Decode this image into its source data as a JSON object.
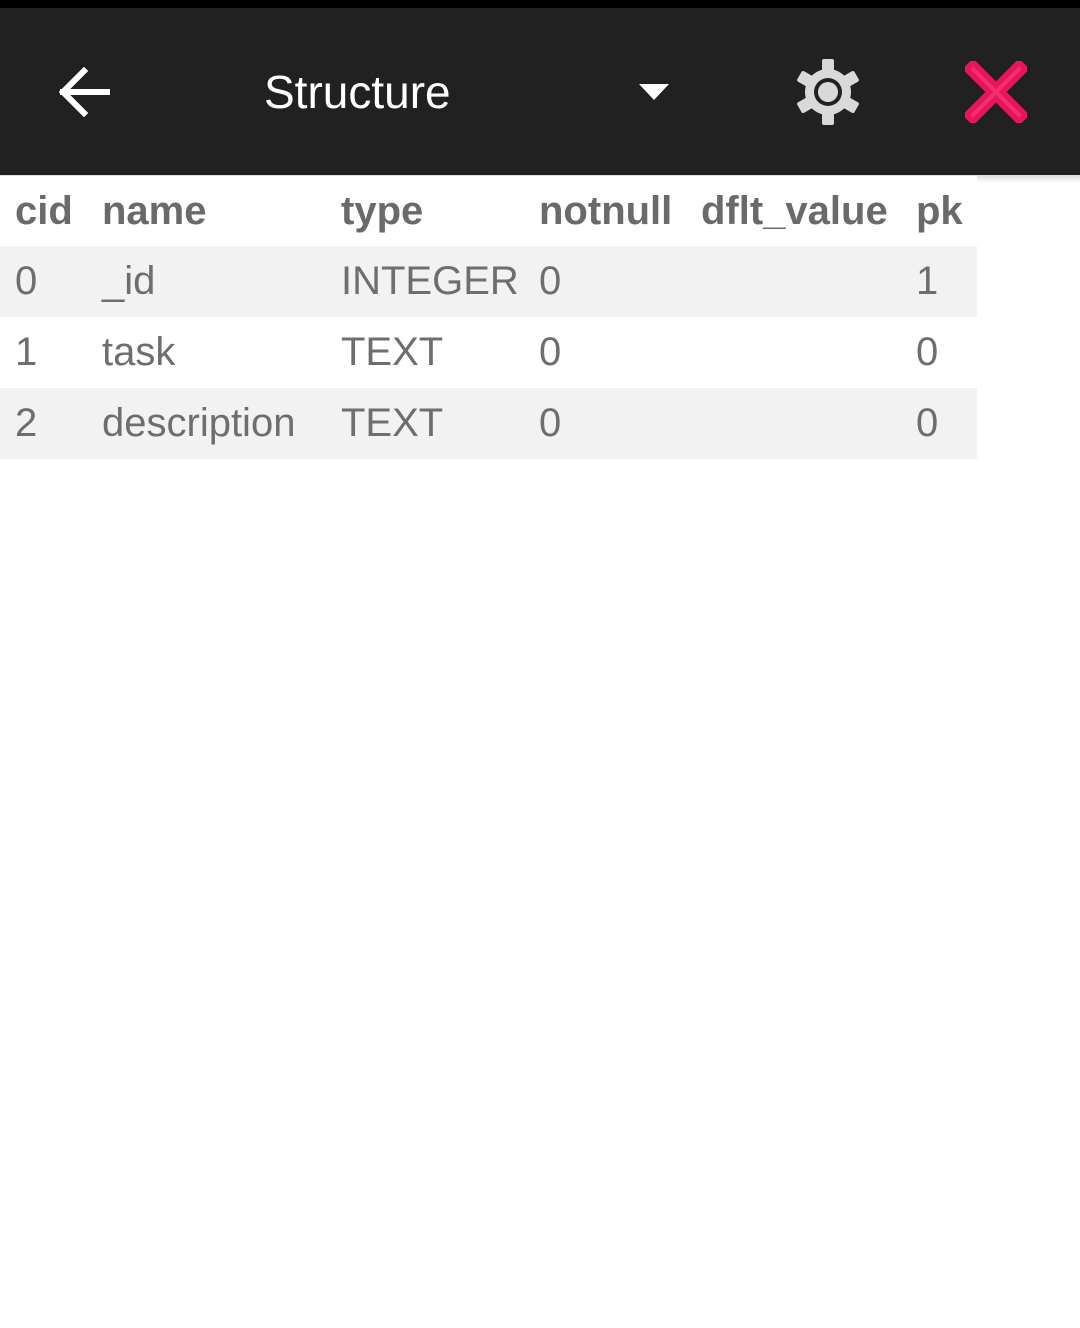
{
  "toolbar": {
    "title": "Structure",
    "icons": {
      "back": "arrow-left-icon",
      "dropdown": "triangle-down-icon",
      "settings": "gear-icon",
      "close": "close-icon"
    },
    "colors": {
      "background": "#212121",
      "title": "#ffffff",
      "close": "#e8155b"
    }
  },
  "table": {
    "columns": [
      "cid",
      "name",
      "type",
      "notnull",
      "dflt_value",
      "pk"
    ],
    "rows": [
      [
        "0",
        "_id",
        "INTEGER",
        "0",
        "",
        "1"
      ],
      [
        "1",
        "task",
        "TEXT",
        "0",
        "",
        "0"
      ],
      [
        "2",
        "description",
        "TEXT",
        "0",
        "",
        "0"
      ]
    ],
    "colors": {
      "header_text": "#6a6a6a",
      "cell_text": "#6e6e6e",
      "stripe": "#f2f2f2"
    }
  }
}
